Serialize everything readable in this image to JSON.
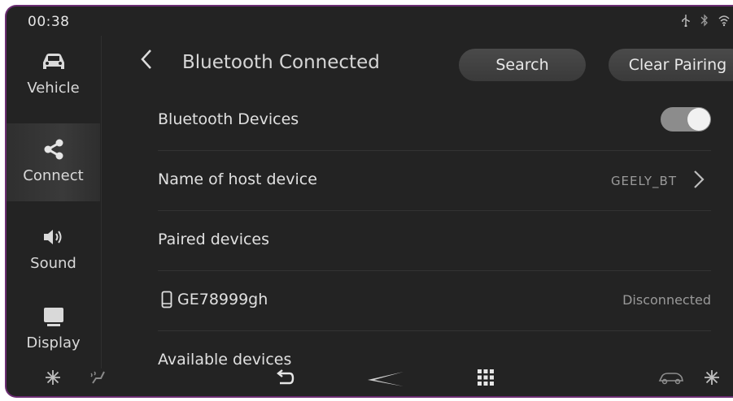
{
  "status": {
    "time": "00:38",
    "icons": [
      "usb-icon",
      "bluetooth-icon",
      "wifi-icon"
    ]
  },
  "sidebar": {
    "items": [
      {
        "label": "Vehicle",
        "icon": "car-icon"
      },
      {
        "label": "Connect",
        "icon": "share-icon",
        "active": true
      },
      {
        "label": "Sound",
        "icon": "speaker-icon"
      },
      {
        "label": "Display",
        "icon": "monitor-icon"
      }
    ]
  },
  "header": {
    "title": "Bluetooth Connected",
    "search_label": "Search",
    "clear_label": "Clear Pairing"
  },
  "rows": {
    "bt_devices_label": "Bluetooth Devices",
    "bt_enabled": true,
    "host_label": "Name of host device",
    "host_value": "GEELY_BT",
    "paired_label": "Paired devices",
    "device_name": "GE78999gh",
    "device_status": "Disconnected",
    "available_label": "Available devices"
  },
  "bottombar": {
    "icons": [
      "fan-left-icon",
      "seat-heat-icon",
      "back-icon",
      "home-logo-icon",
      "apps-grid-icon",
      "car-climate-icon",
      "fan-right-icon"
    ]
  },
  "colors": {
    "background": "#232323",
    "button": "#444444",
    "toggle_on": "#8c8c8c"
  }
}
